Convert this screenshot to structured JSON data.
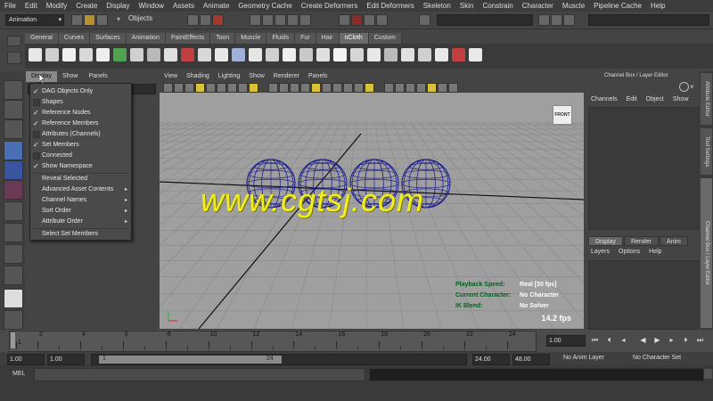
{
  "menubar": [
    "File",
    "Edit",
    "Modify",
    "Create",
    "Display",
    "Window",
    "Assets",
    "Animate",
    "Geometry Cache",
    "Create Deformers",
    "Edit Deformers",
    "Skeleton",
    "Skin",
    "Constrain",
    "Character",
    "Muscle",
    "Pipeline Cache",
    "Help"
  ],
  "status": {
    "mode": "Animation",
    "objects_label": "Objects"
  },
  "shelf_tabs": [
    {
      "label": "General",
      "active": false
    },
    {
      "label": "Curves",
      "active": false
    },
    {
      "label": "Surfaces",
      "active": false
    },
    {
      "label": "Animation",
      "active": false
    },
    {
      "label": "PaintEffects",
      "active": false
    },
    {
      "label": "Toon",
      "active": false
    },
    {
      "label": "Muscle",
      "active": false
    },
    {
      "label": "Fluids",
      "active": false
    },
    {
      "label": "Fur",
      "active": false
    },
    {
      "label": "Hair",
      "active": false
    },
    {
      "label": "nCloth",
      "active": true
    },
    {
      "label": "Custom",
      "active": false
    }
  ],
  "outliner_menu": [
    "Display",
    "Show",
    "Panels"
  ],
  "display_menu": [
    {
      "label": "DAG Objects Only",
      "type": "check",
      "checked": true
    },
    {
      "label": "Shapes",
      "type": "check",
      "checked": false
    },
    {
      "label": "Reference Nodes",
      "type": "check",
      "checked": true
    },
    {
      "label": "Reference Members",
      "type": "check",
      "checked": true
    },
    {
      "label": "Attributes (Channels)",
      "type": "check",
      "checked": false
    },
    {
      "label": "Set Members",
      "type": "check",
      "checked": true
    },
    {
      "label": "Connected",
      "type": "check",
      "checked": false
    },
    {
      "label": "Show Namespace",
      "type": "check",
      "checked": true
    },
    {
      "label": "Reveal Selected",
      "type": "item"
    },
    {
      "label": "Advanced Asset Contents",
      "type": "submenu"
    },
    {
      "label": "Channel Names",
      "type": "submenu"
    },
    {
      "label": "Sort Order",
      "type": "submenu"
    },
    {
      "label": "Attribute Order",
      "type": "submenu"
    },
    {
      "label": "Select Set Members",
      "type": "item"
    }
  ],
  "viewport": {
    "menu": [
      "View",
      "Shading",
      "Lighting",
      "Show",
      "Renderer",
      "Panels"
    ],
    "view_cube": "FRONT",
    "hud": [
      {
        "key": "Playback Speed:",
        "value": "Real [30 fps]"
      },
      {
        "key": "Current Character:",
        "value": "No Character"
      },
      {
        "key": "IK Blend:",
        "value": "No Solver"
      }
    ],
    "fps": "14.2 fps",
    "watermark": "www.cgtsj.com",
    "spheres": 4
  },
  "channel_box": {
    "title": "Channel Box / Layer Editor",
    "menu": [
      "Channels",
      "Edit",
      "Object",
      "Show"
    ],
    "layer_tabs": [
      {
        "label": "Display",
        "active": true
      },
      {
        "label": "Render",
        "active": false
      },
      {
        "label": "Anim",
        "active": false
      }
    ],
    "layer_menu": [
      "Layers",
      "Options",
      "Help"
    ]
  },
  "side_tabs": [
    "Attribute Editor",
    "Tool Settings",
    "Channel Box / Layer Editor"
  ],
  "timeslider": {
    "ticks": [
      "1",
      "2",
      "4",
      "6",
      "8",
      "10",
      "12",
      "14",
      "16",
      "18",
      "20",
      "22",
      "24"
    ],
    "current_frame": "1.00"
  },
  "range": {
    "start": "1.00",
    "playback_start": "1.00",
    "slider_start": "1",
    "slider_end": "24",
    "playback_end": "24.00",
    "end": "48.00",
    "anim_layer": "No Anim Layer",
    "character_set": "No Character Set"
  },
  "cmdline": {
    "label": "MEL"
  },
  "colors": {
    "viewport_bg": "#9f9f9f",
    "hud_key": "#0b5e20",
    "watermark": "#f2ee1e",
    "wireframe": "#1a1a8c"
  }
}
